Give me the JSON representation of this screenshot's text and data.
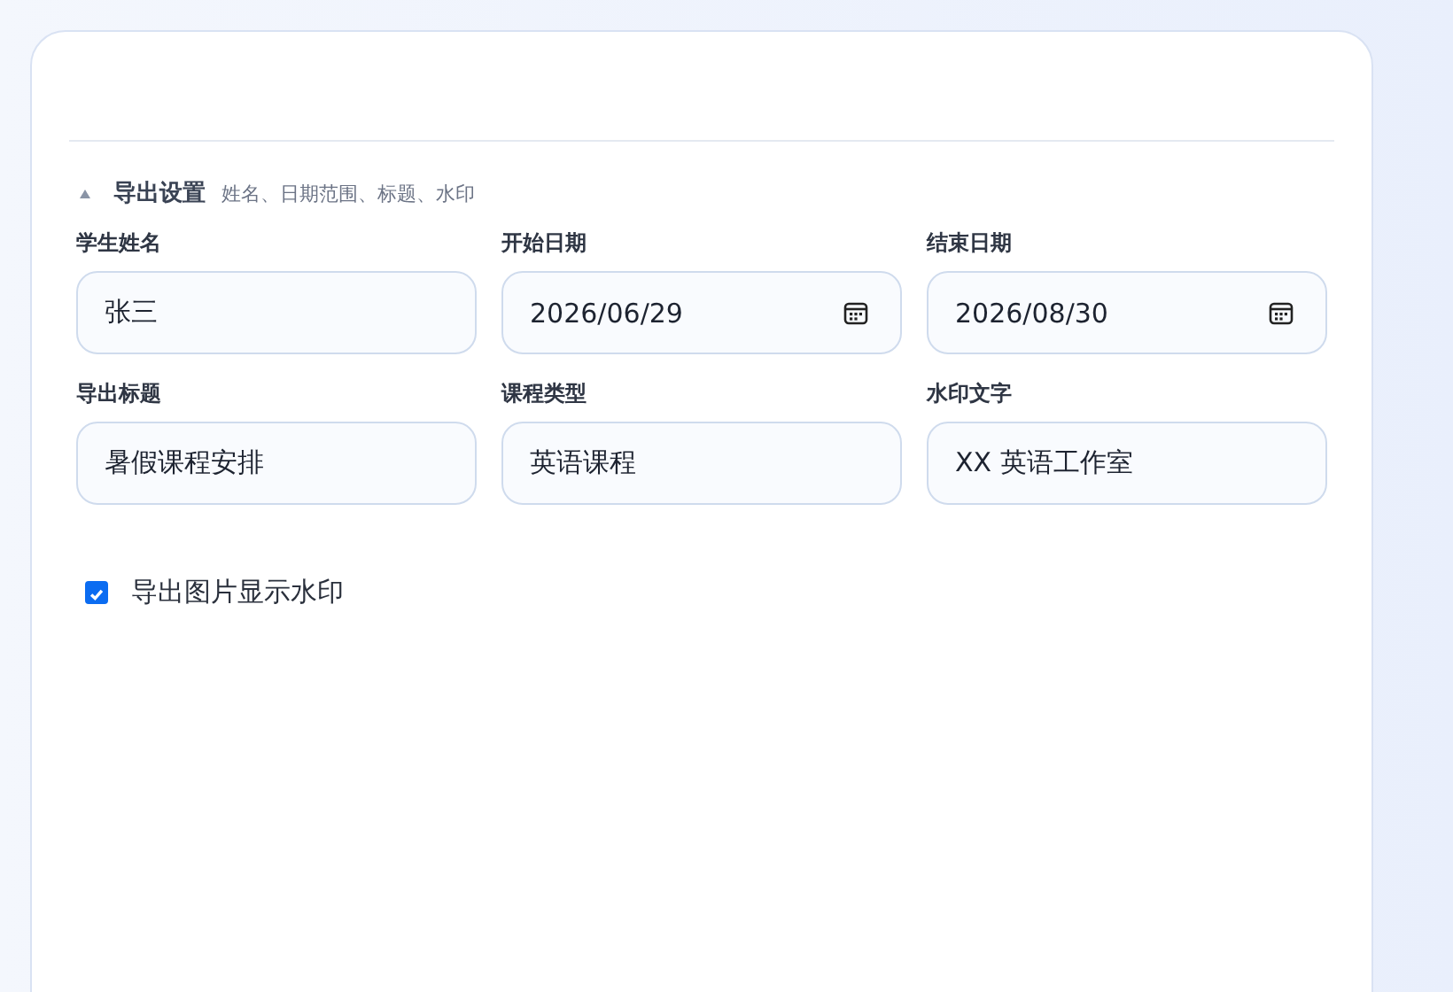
{
  "section": {
    "title": "导出设置",
    "subtitle": "姓名、日期范围、标题、水印",
    "expanded": true
  },
  "fields": [
    {
      "label": "学生姓名",
      "value": "张三",
      "kind": "text"
    },
    {
      "label": "开始日期",
      "value": "2026/06/29",
      "kind": "date"
    },
    {
      "label": "结束日期",
      "value": "2026/08/30",
      "kind": "date"
    },
    {
      "label": "导出标题",
      "value": "暑假课程安排",
      "kind": "text"
    },
    {
      "label": "课程类型",
      "value": "英语课程",
      "kind": "text"
    },
    {
      "label": "水印文字",
      "value": "XX 英语工作室",
      "kind": "text"
    }
  ],
  "watermark_option": {
    "label": "导出图片显示水印",
    "checked": true
  }
}
